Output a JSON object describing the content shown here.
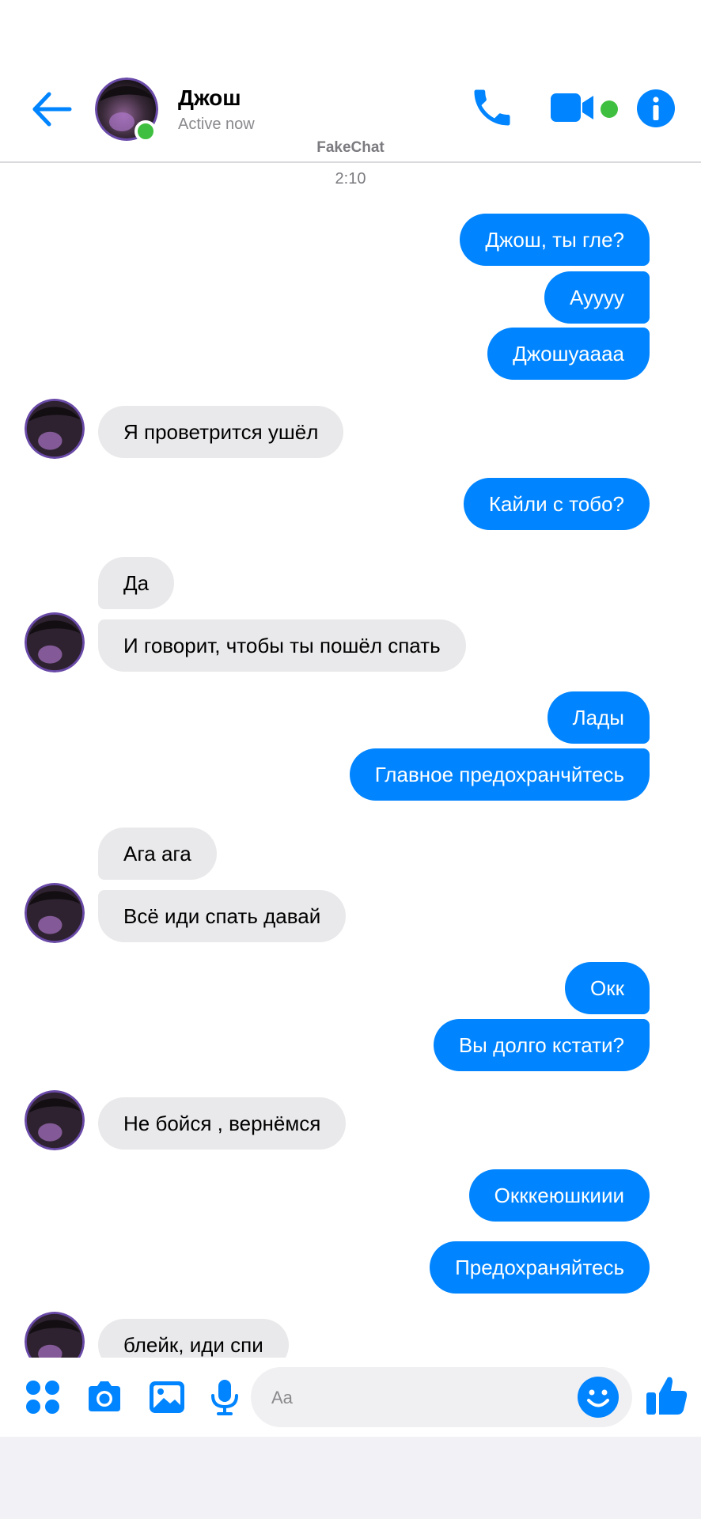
{
  "app": {
    "brand": "FakeChat",
    "accent_color": "#0084ff"
  },
  "header": {
    "contact_name": "Джош",
    "contact_status": "Active now",
    "back_icon": "arrow-left-icon",
    "call_icon": "phone-icon",
    "video_icon": "video-camera-icon",
    "info_icon": "info-icon"
  },
  "conversation": {
    "timestamp": "2:10",
    "messages": [
      {
        "dir": "out",
        "text": "Джош, ты гле?"
      },
      {
        "dir": "out",
        "text": "Ауууу"
      },
      {
        "dir": "out",
        "text": "Джошуаааа"
      },
      {
        "dir": "in",
        "text": "Я проветрится ушёл"
      },
      {
        "dir": "out",
        "text": "Кайли с тобо?"
      },
      {
        "dir": "in",
        "text": "Да"
      },
      {
        "dir": "in",
        "text": "И говорит, чтобы ты пошёл спать"
      },
      {
        "dir": "out",
        "text": "Лады"
      },
      {
        "dir": "out",
        "text": "Главное предохранчйтесь"
      },
      {
        "dir": "in",
        "text": "Ага ага"
      },
      {
        "dir": "in",
        "text": "Всё иди спать давай"
      },
      {
        "dir": "out",
        "text": "Окк"
      },
      {
        "dir": "out",
        "text": "Вы долго кстати?"
      },
      {
        "dir": "in",
        "text": "Не бойся , вернёмся"
      },
      {
        "dir": "out",
        "text": "Окккеюшкиии"
      },
      {
        "dir": "out",
        "text": "Предохраняйтесь"
      },
      {
        "dir": "in",
        "text": "блейк, иди спи"
      }
    ]
  },
  "composer": {
    "placeholder": "Aa",
    "tools": [
      "apps-grid-icon",
      "camera-icon",
      "gallery-icon",
      "microphone-icon"
    ],
    "emoji_icon": "emoji-icon",
    "like_icon": "thumbs-up-icon"
  }
}
